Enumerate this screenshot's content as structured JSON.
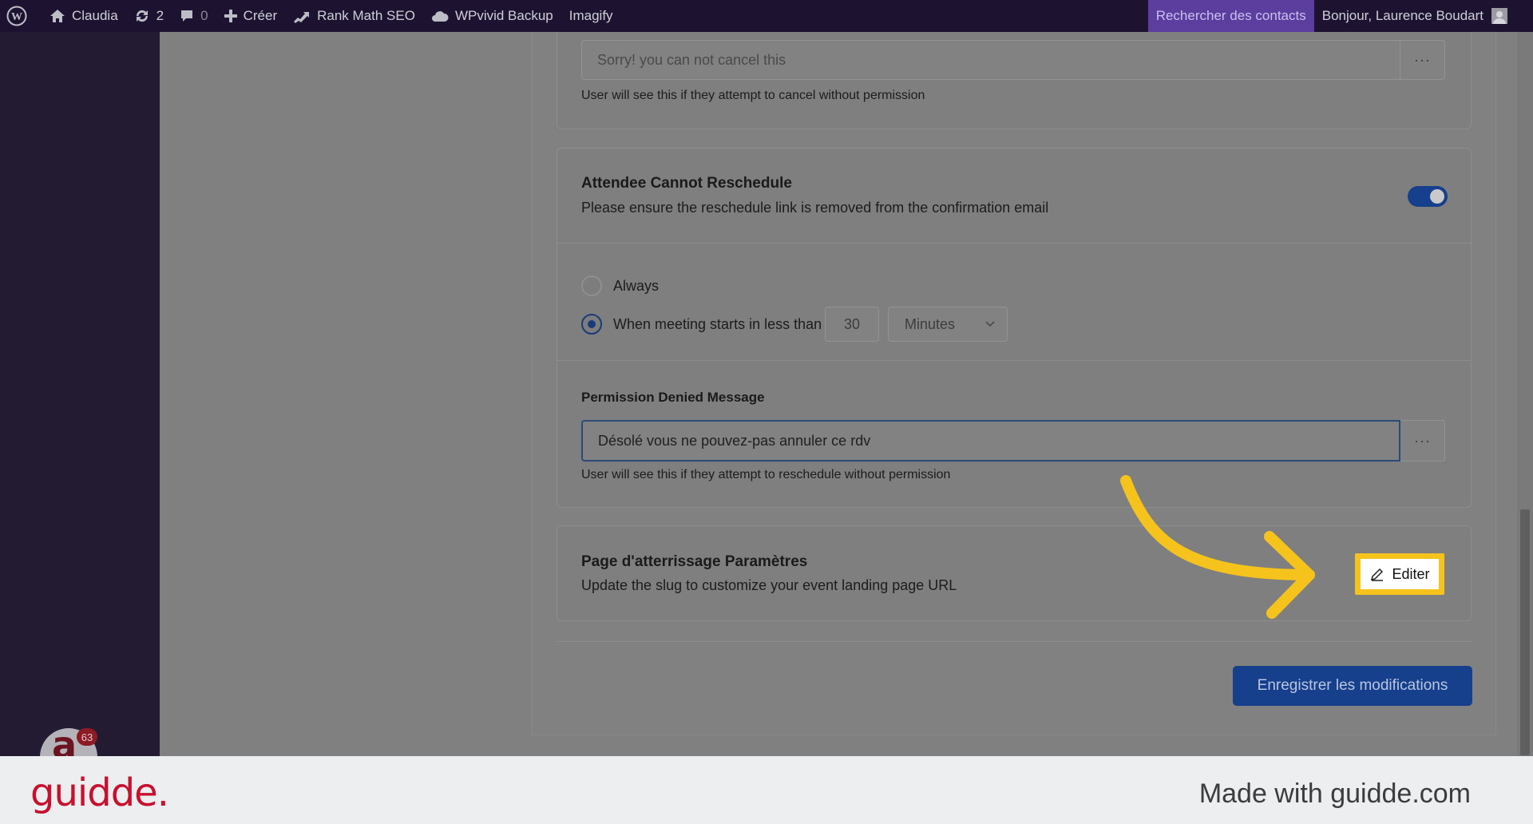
{
  "adminbar": {
    "site_name": "Claudia",
    "updates_count": "2",
    "comments_count": "0",
    "create_label": "Créer",
    "rankmath_label": "Rank Math SEO",
    "wpvivid_label": "WPvivid Backup",
    "imagify_label": "Imagify",
    "search_contacts": "Rechercher des contacts",
    "greeting": "Bonjour, Laurence Boudart"
  },
  "sidebar": {
    "notification_count": "63"
  },
  "cancel_section": {
    "message_value": "Sorry! you can not cancel this",
    "help_text": "User will see this if they attempt to cancel without permission"
  },
  "reschedule_section": {
    "title": "Attendee Cannot Reschedule",
    "description": "Please ensure the reschedule link is removed from the confirmation email",
    "toggle_on": true,
    "option_always": "Always",
    "option_when": "When meeting starts in less than",
    "minutes_value": "30",
    "unit_selected": "Minutes",
    "permission_label": "Permission Denied Message",
    "permission_value": "Désolé vous ne pouvez-pas annuler ce rdv",
    "permission_help": "User will see this if they attempt to reschedule without permission"
  },
  "landing_section": {
    "title": "Page d'atterrissage Paramètres",
    "description": "Update the slug to customize your event landing page URL",
    "edit_label": "Editer"
  },
  "save_label": "Enregistrer les modifications",
  "footer": {
    "brand": "guidde.",
    "made_with": "Made with guidde.com"
  },
  "colors": {
    "accent": "#163f8c",
    "highlight": "#f5c31c",
    "brand": "#c8102e"
  }
}
